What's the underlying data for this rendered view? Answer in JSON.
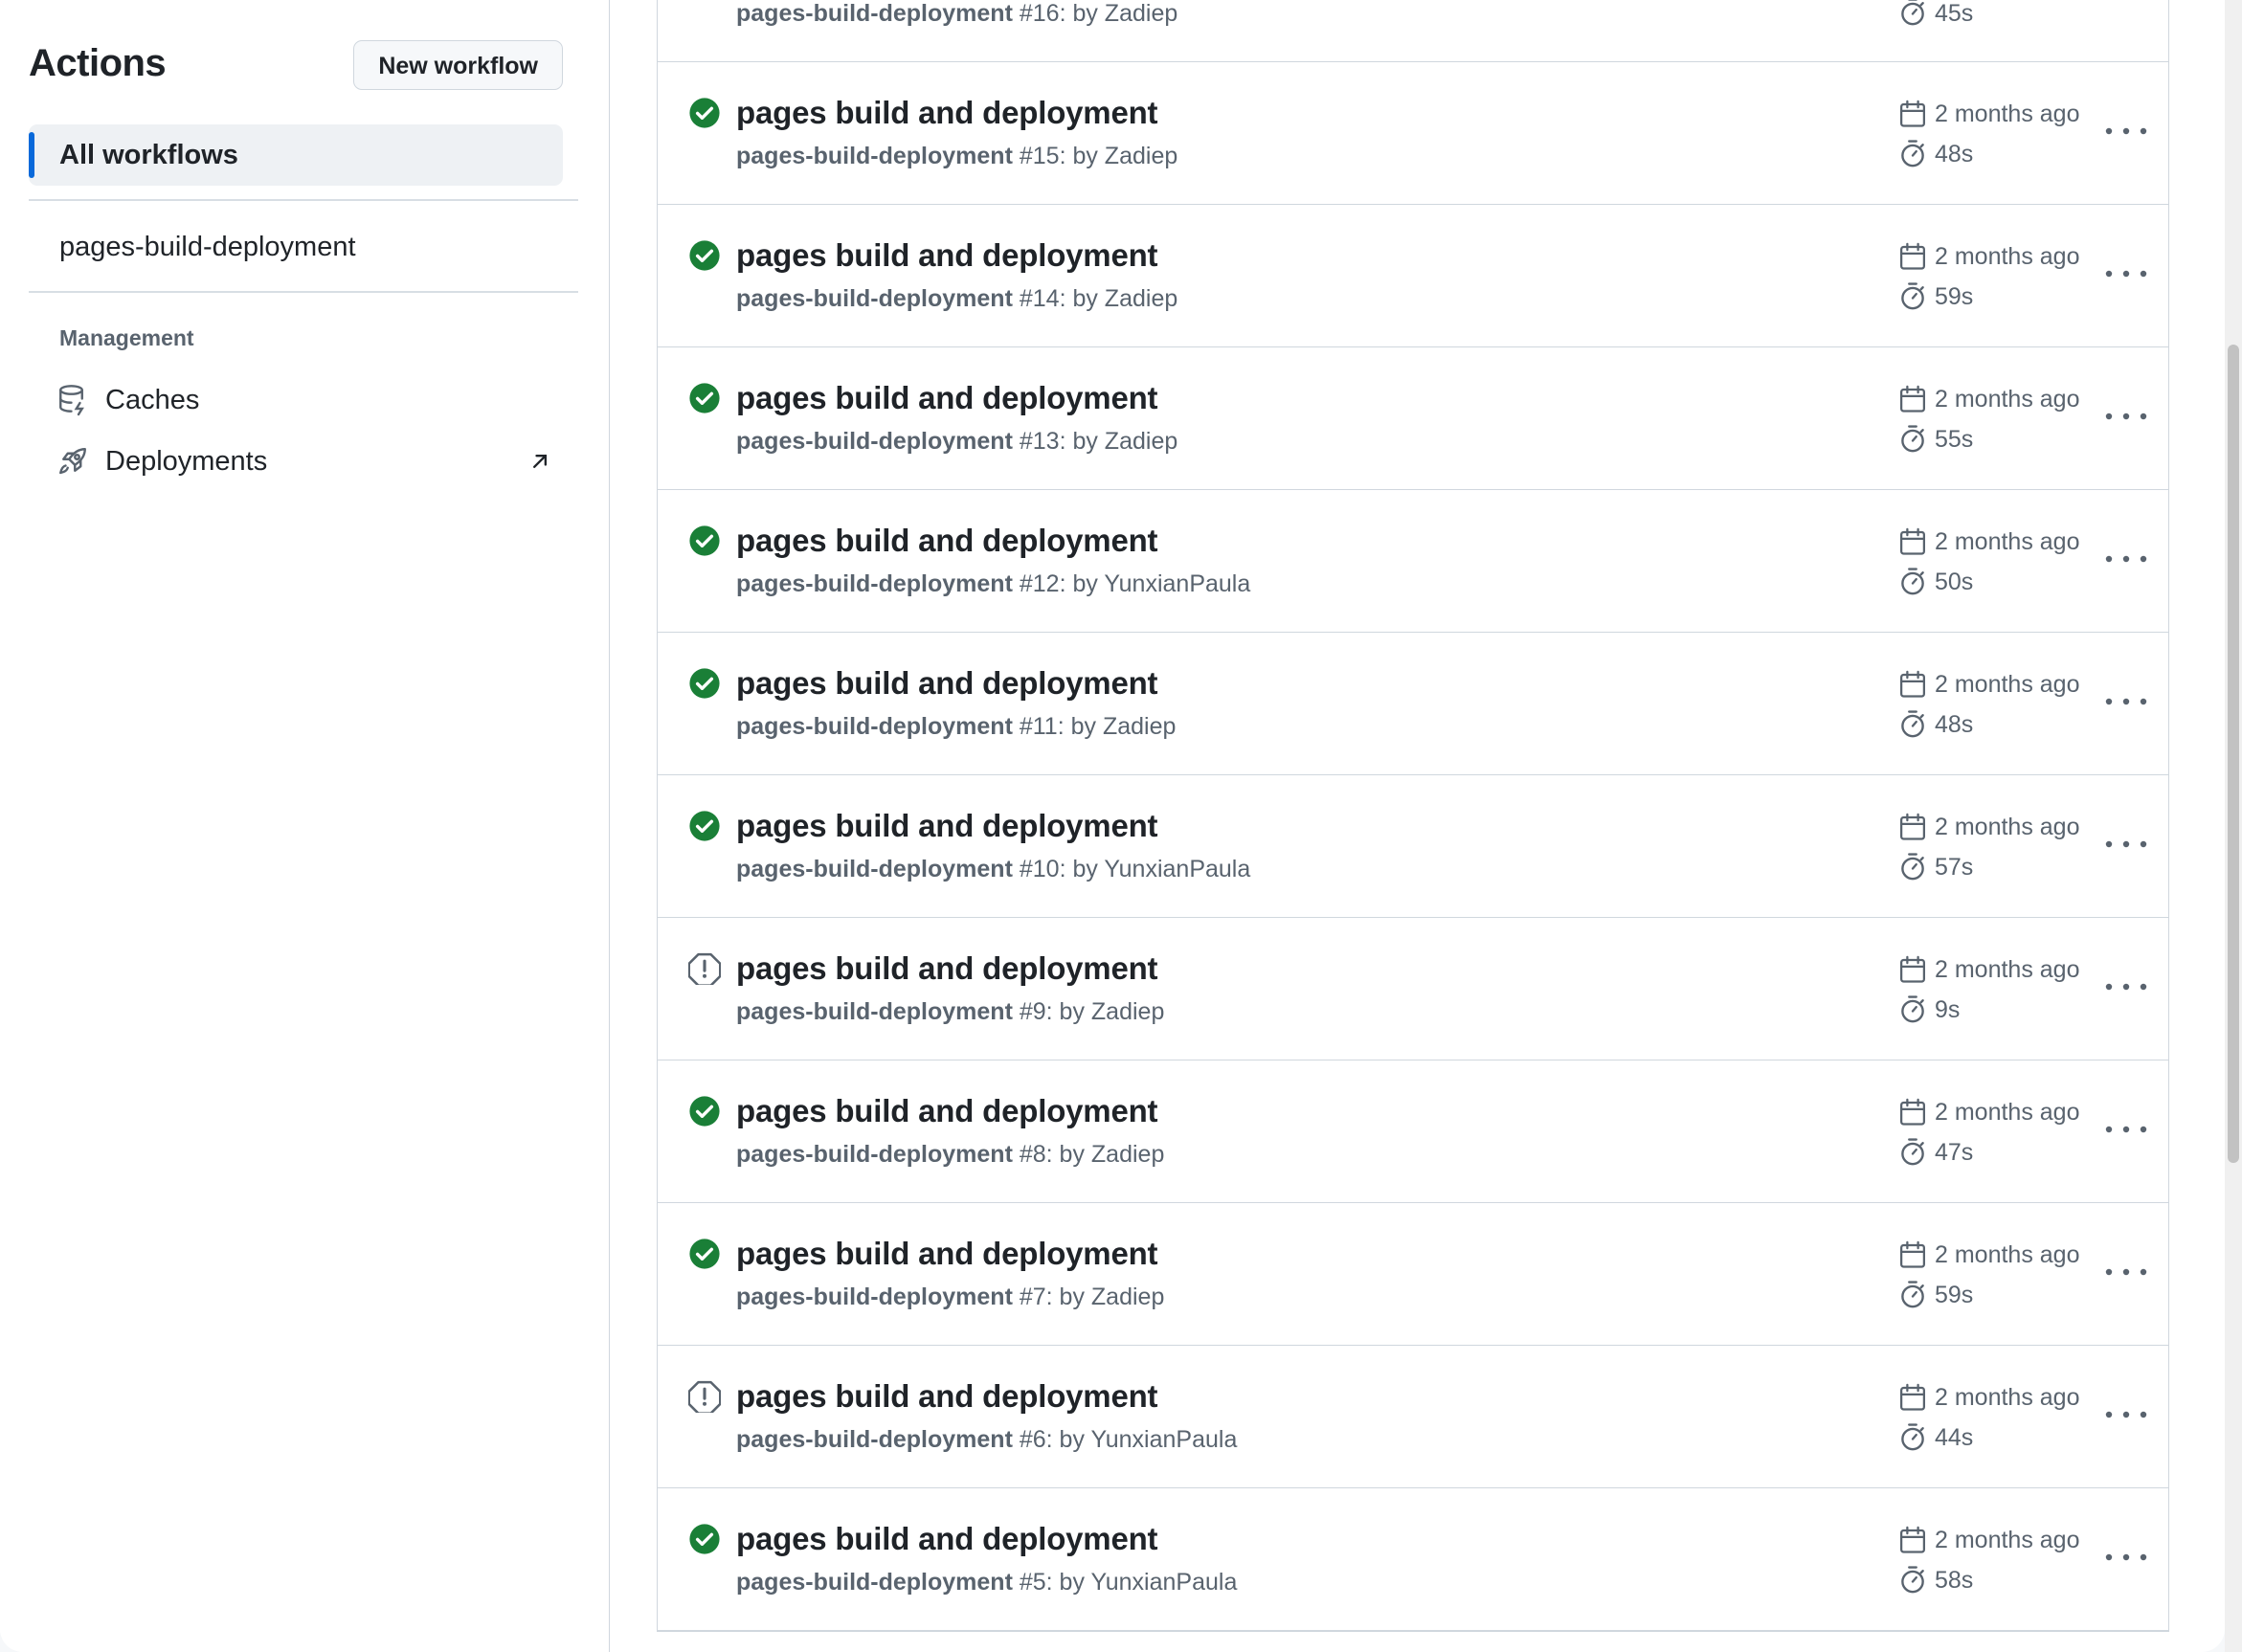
{
  "sidebar": {
    "title": "Actions",
    "new_workflow_label": "New workflow",
    "all_workflows_label": "All workflows",
    "workflow_item": "pages-build-deployment",
    "management_label": "Management",
    "caches_label": "Caches",
    "deployments_label": "Deployments"
  },
  "colors": {
    "accent": "#0969da",
    "success": "#1a7f37",
    "muted": "#59636e"
  },
  "runs": [
    {
      "title": "",
      "workflow": "pages-build-deployment",
      "run": " #16: by Zadiep",
      "date": "",
      "duration": "45s",
      "status": "success"
    },
    {
      "title": "pages build and deployment",
      "workflow": "pages-build-deployment",
      "run": " #15: by Zadiep",
      "date": "2 months ago",
      "duration": "48s",
      "status": "success"
    },
    {
      "title": "pages build and deployment",
      "workflow": "pages-build-deployment",
      "run": " #14: by Zadiep",
      "date": "2 months ago",
      "duration": "59s",
      "status": "success"
    },
    {
      "title": "pages build and deployment",
      "workflow": "pages-build-deployment",
      "run": " #13: by Zadiep",
      "date": "2 months ago",
      "duration": "55s",
      "status": "success"
    },
    {
      "title": "pages build and deployment",
      "workflow": "pages-build-deployment",
      "run": " #12: by YunxianPaula",
      "date": "2 months ago",
      "duration": "50s",
      "status": "success"
    },
    {
      "title": "pages build and deployment",
      "workflow": "pages-build-deployment",
      "run": " #11: by Zadiep",
      "date": "2 months ago",
      "duration": "48s",
      "status": "success"
    },
    {
      "title": "pages build and deployment",
      "workflow": "pages-build-deployment",
      "run": " #10: by YunxianPaula",
      "date": "2 months ago",
      "duration": "57s",
      "status": "success"
    },
    {
      "title": "pages build and deployment",
      "workflow": "pages-build-deployment",
      "run": " #9: by Zadiep",
      "date": "2 months ago",
      "duration": "9s",
      "status": "warning"
    },
    {
      "title": "pages build and deployment",
      "workflow": "pages-build-deployment",
      "run": " #8: by Zadiep",
      "date": "2 months ago",
      "duration": "47s",
      "status": "success"
    },
    {
      "title": "pages build and deployment",
      "workflow": "pages-build-deployment",
      "run": " #7: by Zadiep",
      "date": "2 months ago",
      "duration": "59s",
      "status": "success"
    },
    {
      "title": "pages build and deployment",
      "workflow": "pages-build-deployment",
      "run": " #6: by YunxianPaula",
      "date": "2 months ago",
      "duration": "44s",
      "status": "warning"
    },
    {
      "title": "pages build and deployment",
      "workflow": "pages-build-deployment",
      "run": " #5: by YunxianPaula",
      "date": "2 months ago",
      "duration": "58s",
      "status": "success"
    }
  ]
}
